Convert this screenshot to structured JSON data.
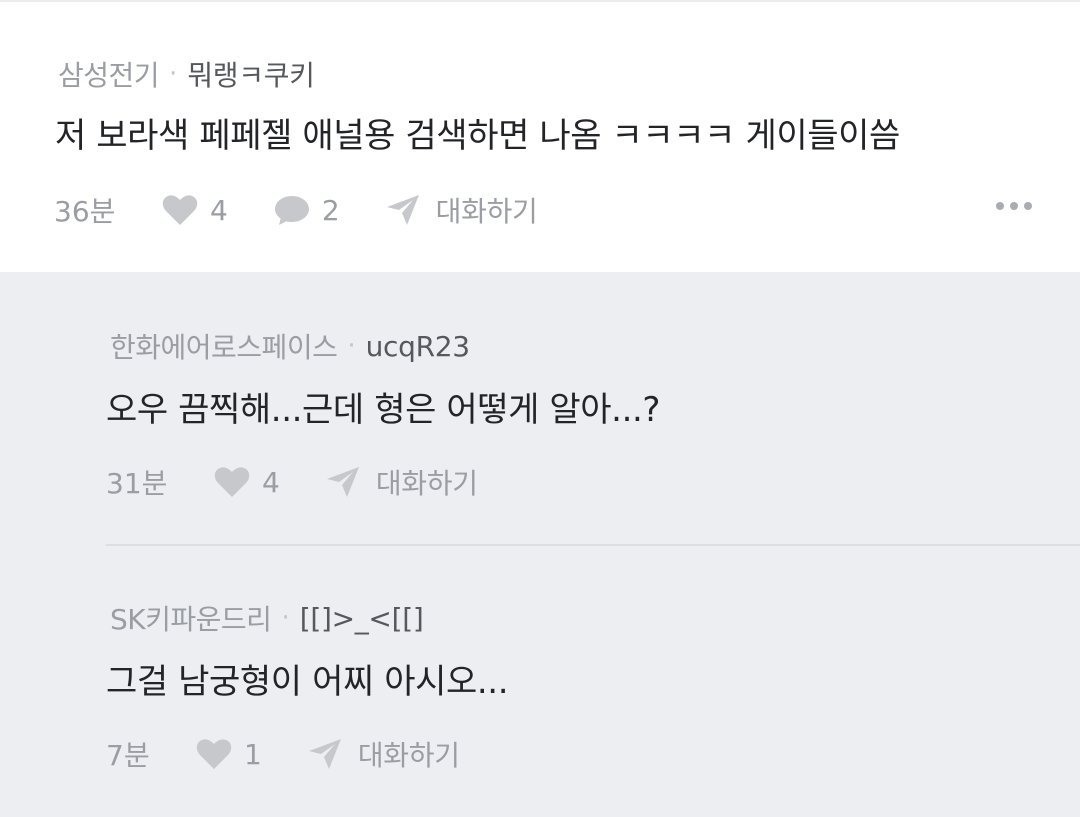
{
  "main_comment": {
    "company": "삼성전기",
    "separator": "·",
    "nickname": "뭐랭ㅋ쿠키",
    "text": "저 보라색 페페젤 애널용 검색하면 나옴 ㅋㅋㅋㅋ 게이들이씀",
    "time": "36분",
    "likes": "4",
    "replies": "2",
    "chat_label": "대화하기"
  },
  "replies": [
    {
      "company": "한화에어로스페이스",
      "separator": "·",
      "nickname": "ucqR23",
      "text": "오우 끔찍해...근데 형은 어떻게 알아...?",
      "time": "31분",
      "likes": "4",
      "chat_label": "대화하기"
    },
    {
      "company": "SK키파운드리",
      "separator": "·",
      "nickname": "[[]>_<[[]",
      "text": "그걸 남궁형이 어찌 아시오...",
      "time": "7분",
      "likes": "1",
      "chat_label": "대화하기"
    }
  ],
  "icons": {
    "like": "heart-icon",
    "reply": "speech-bubble-icon",
    "chat": "paper-plane-icon",
    "more": "more-dots-icon"
  },
  "colors": {
    "reply_background": "#eceef2",
    "icon_gray": "#c6c8cc",
    "text_dark": "#232427"
  }
}
